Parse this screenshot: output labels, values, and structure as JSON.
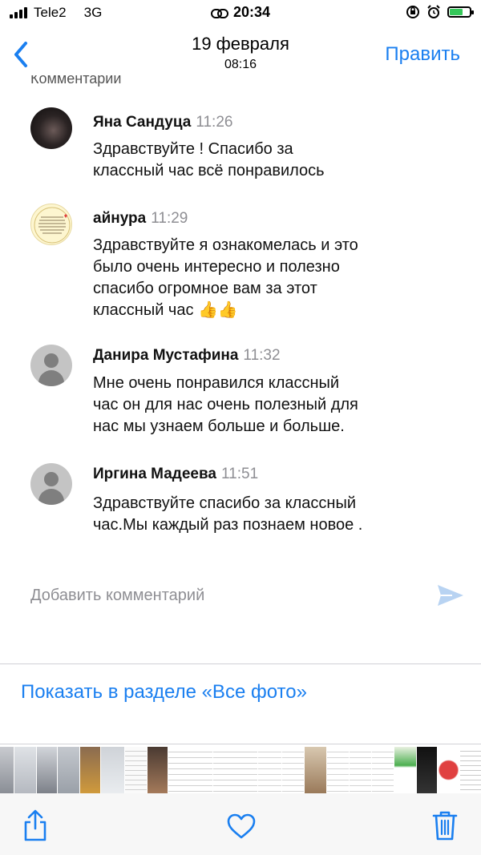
{
  "status_bar": {
    "carrier": "Tele2",
    "network": "3G",
    "time": "20:34"
  },
  "header": {
    "back_icon": "chevron-left-icon",
    "title": "19 февраля",
    "subtitle": "08:16",
    "edit_label": "Править"
  },
  "comments_section": {
    "title": "Комментарии"
  },
  "comments": [
    {
      "name": "Яна Сандуца",
      "time": "11:26",
      "lines": [
        "Здравствуйте ! Спасибо за",
        "классный час всё понравилось"
      ]
    },
    {
      "name": "айнура",
      "time": "11:29",
      "lines": [
        "Здравствуйте я ознакомелась и это",
        "было очень интересно и полезно",
        "спасибо огромное вам за этот",
        "классный час 👍👍"
      ]
    },
    {
      "name": "Данира Мустафина",
      "time": "11:32",
      "lines": [
        "Мне очень понравился  классный",
        "час он для нас очень полезный для",
        "нас мы узнаем  больше и больше."
      ]
    },
    {
      "name": "Иргина Мадеева",
      "time": "11:51",
      "lines": [
        "Здравствуйте спасибо за классный",
        "час.Мы каждый раз познаем новое ."
      ]
    }
  ],
  "add_comment": {
    "placeholder": "Добавить комментарий",
    "send_icon": "send-icon"
  },
  "show_in_all_photos": "Показать в разделе «Все фото»",
  "toolbar": {
    "share_icon": "share-icon",
    "favorite_icon": "heart-icon",
    "delete_icon": "trash-icon"
  },
  "colors": {
    "accent": "#1a7ff0",
    "secondary_text": "#8e8e93",
    "battery_charging": "#34c759"
  }
}
